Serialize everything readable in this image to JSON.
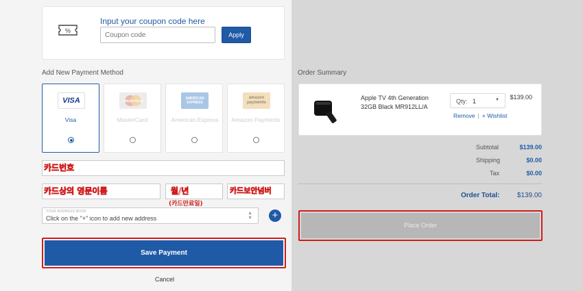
{
  "coupon": {
    "title": "Input your coupon code here",
    "placeholder": "Coupon code",
    "apply_label": "Apply"
  },
  "payment": {
    "section_title": "Add New Payment Method",
    "methods": [
      {
        "label": "Visa",
        "logo": "VISA",
        "selected": true
      },
      {
        "label": "MasterCard",
        "logo": "MasterCard",
        "selected": false
      },
      {
        "label": "American Express",
        "logo": "AMERICAN EXPRESS",
        "selected": false
      },
      {
        "label": "Amazon Payments",
        "logo": "amazon payments",
        "selected": false
      }
    ],
    "card_number_label": "카드번호",
    "holder_name_label": "카드상의 영문이름",
    "expiry_label": "월/년",
    "expiry_note": "(카드만료일)",
    "cvv_label": "카드보안넘버",
    "address_caption": "YOUR ADDRESS BOOK",
    "address_text": "Click on the \"+\" icon to add new address",
    "add_address_symbol": "+",
    "save_label": "Save Payment",
    "cancel_label": "Cancel"
  },
  "order": {
    "section_title": "Order Summary",
    "item": {
      "name_line1": "Apple TV 4th Generation",
      "name_line2": "32GB Black MR912LL/A",
      "qty_label": "Qty:",
      "qty_value": "1",
      "remove_label": "Remove",
      "separator": "|",
      "wishlist_label": "+ Wishlist",
      "price": "$139.00"
    },
    "subtotal_label": "Subtotal",
    "subtotal_value": "$139.00",
    "shipping_label": "Shipping",
    "shipping_value": "$0.00",
    "tax_label": "Tax",
    "tax_value": "$0.00",
    "total_label": "Order Total:",
    "total_value": "$139.00",
    "place_label": "Place Order"
  },
  "colors": {
    "accent": "#1f5aa6",
    "highlight_border": "#d01c1c",
    "right_panel_bg": "#d7d7d7"
  }
}
